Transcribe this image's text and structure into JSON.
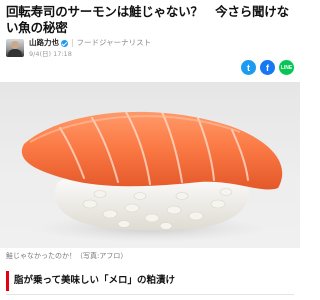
{
  "article": {
    "title": "回転寿司のサーモンは鮭じゃない？　今さら聞けない魚の秘密"
  },
  "author": {
    "name": "山路力也",
    "role": "フードジャーナリスト",
    "separator": "|",
    "date": "9/4(日) 17:18"
  },
  "share": {
    "twitter_icon": "t",
    "facebook_icon": "f",
    "line_icon": "LINE"
  },
  "photo": {
    "caption": "鮭じゃなかったのか！（写真:アフロ）"
  },
  "section": {
    "heading": "脂が乗って美味しい「メロ」の粕漬け"
  },
  "colors": {
    "accent": "#e60012",
    "twitter": "#1d9bf0",
    "facebook": "#1877f2",
    "line": "#06c755"
  }
}
